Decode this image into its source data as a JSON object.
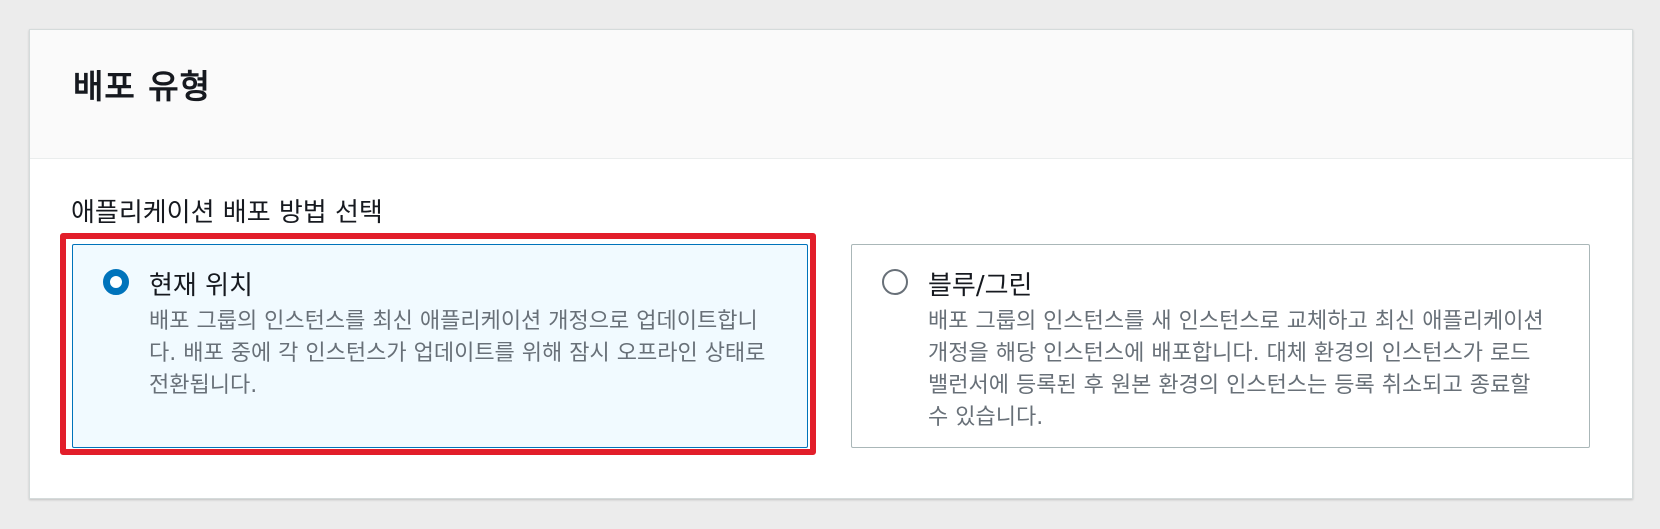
{
  "section": {
    "title": "배포 유형"
  },
  "deployment": {
    "label": "애플리케이션 배포 방법 선택",
    "options": [
      {
        "title": "현재 위치",
        "description": "배포 그룹의 인스턴스를 최신 애플리케이션 개정으로 업데이트합니다. 배포 중에 각 인스턴스가 업데이트를 위해 잠시 오프라인 상태로 전환됩니다.",
        "selected": true
      },
      {
        "title": "블루/그린",
        "description": "배포 그룹의 인스턴스를 새 인스턴스로 교체하고 최신 애플리케이션 개정을 해당 인스턴스에 배포합니다. 대체 환경의 인스턴스가 로드 밸런서에 등록된 후 원본 환경의 인스턴스는 등록 취소되고 종료할 수 있습니다.",
        "selected": false
      }
    ]
  },
  "colors": {
    "selected_border": "#0073bb",
    "selected_background": "#f1faff",
    "highlight_annotation": "#e21e2a"
  }
}
